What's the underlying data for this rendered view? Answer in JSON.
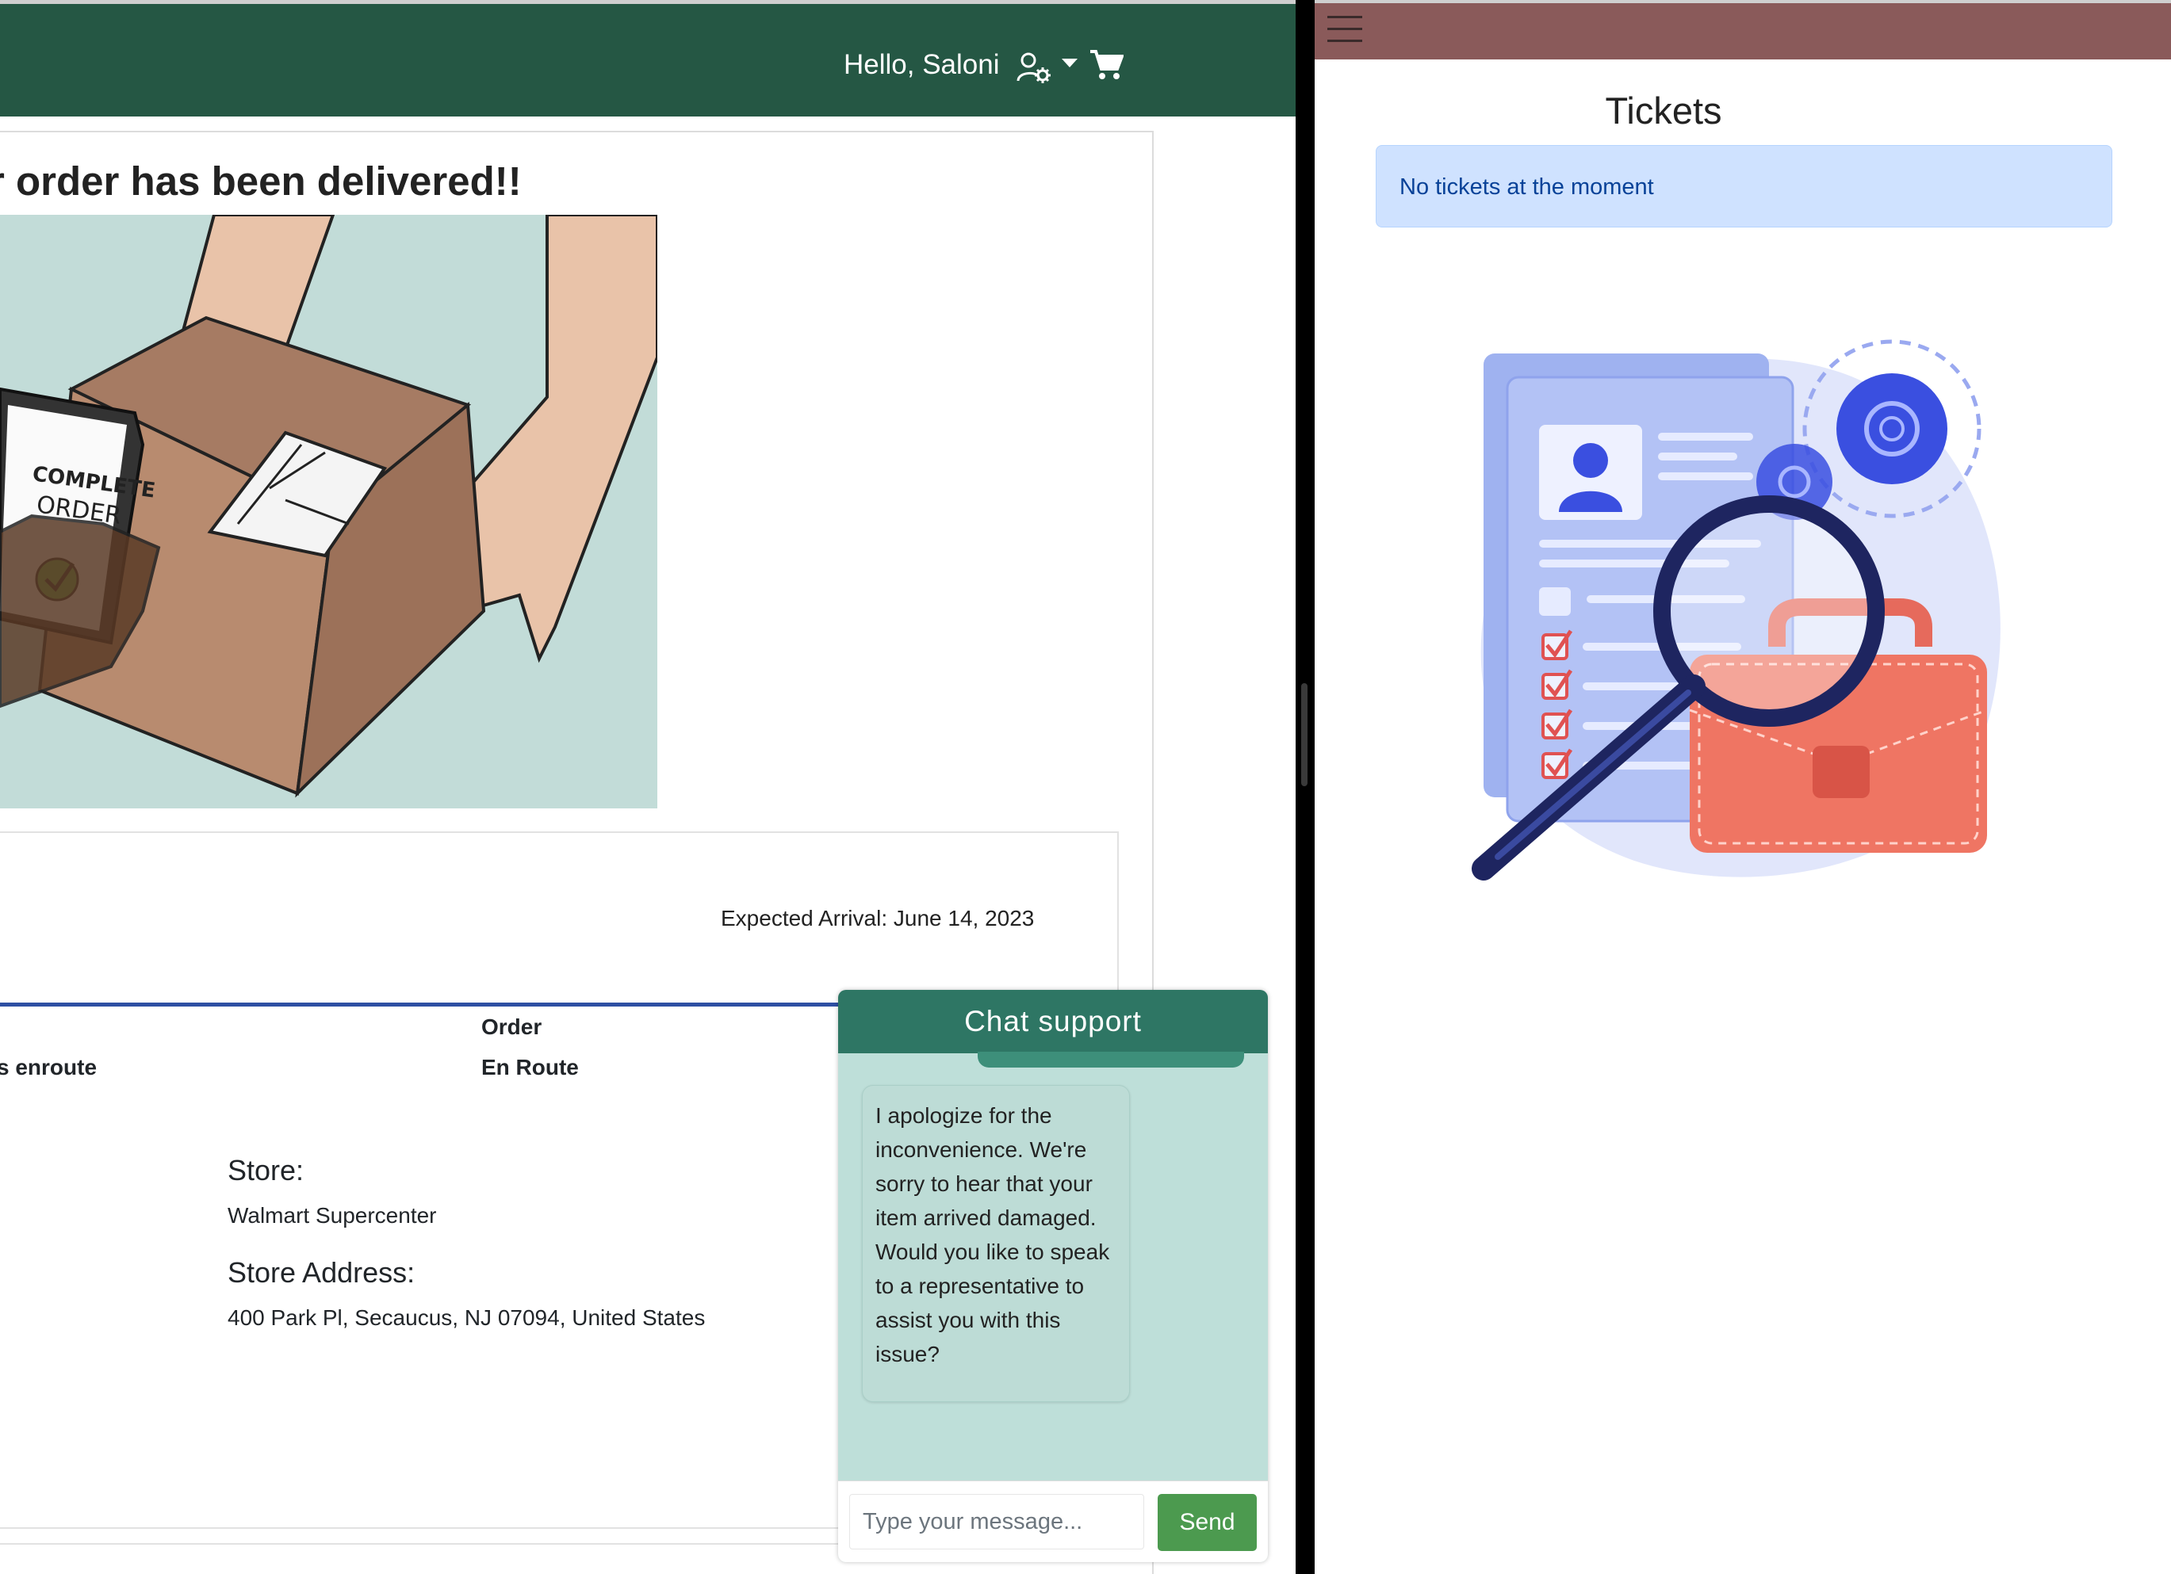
{
  "left_app": {
    "header": {
      "greeting": "Hello, Saloni",
      "user_icon": "user-settings-icon",
      "caret_icon": "caret-down-icon",
      "cart_icon": "shopping-cart-icon",
      "bar_color": "#255744"
    },
    "order": {
      "title": "r order has been delivered!!",
      "illustration_text": "COMPLETE ORDER",
      "expected_arrival": "Expected Arrival: June 14, 2023",
      "status_left_partial": "s enroute",
      "status_label": "Order",
      "status_value": "En Route",
      "store_label": "Store:",
      "store_name": "Walmart Supercenter",
      "store_address_label": "Store Address:",
      "store_address": "400 Park Pl, Secaucus, NJ 07094, United States"
    },
    "chat": {
      "title": "Chat support",
      "message": "I apologize for the inconvenience. We're sorry to hear that your item arrived damaged. Would you like to speak to a representative to assist you with this issue?",
      "input_placeholder": "Type your message...",
      "send_label": "Send",
      "header_color": "#2e7664",
      "body_color": "#bedfd9",
      "send_color": "#4c9a4f"
    }
  },
  "right_app": {
    "header": {
      "menu_icon": "hamburger-menu-icon",
      "bar_color": "#8a5a5a"
    },
    "title": "Tickets",
    "empty_message": "No tickets at the moment",
    "illustration": "ticket-search-illustration"
  }
}
